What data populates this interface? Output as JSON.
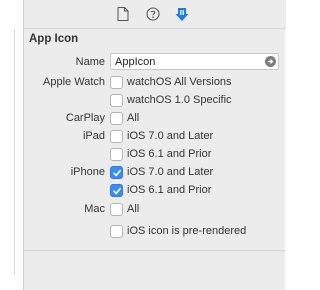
{
  "toolbar": {
    "icons": [
      "file-inspector-icon",
      "quick-help-icon",
      "attributes-inspector-icon"
    ],
    "active_color": "#1f7ae9"
  },
  "app_icon": {
    "section_title": "App Icon",
    "name_label": "Name",
    "name_value": "AppIcon",
    "rows": [
      {
        "label": "Apple Watch",
        "option": "watchOS All Versions",
        "checked": false
      },
      {
        "label": "",
        "option": "watchOS 1.0 Specific",
        "checked": false
      },
      {
        "label": "CarPlay",
        "option": "All",
        "checked": false
      },
      {
        "label": "iPad",
        "option": "iOS 7.0 and Later",
        "checked": false
      },
      {
        "label": "",
        "option": "iOS 6.1 and Prior",
        "checked": false
      },
      {
        "label": "iPhone",
        "option": "iOS 7.0 and Later",
        "checked": true
      },
      {
        "label": "",
        "option": "iOS 6.1 and Prior",
        "checked": true
      },
      {
        "label": "Mac",
        "option": "All",
        "checked": false
      }
    ],
    "prerendered_label": "iOS icon is pre-rendered",
    "prerendered_checked": false
  },
  "colors": {
    "check_blue": "#3b8cf5",
    "panel_bg": "#ececec"
  }
}
